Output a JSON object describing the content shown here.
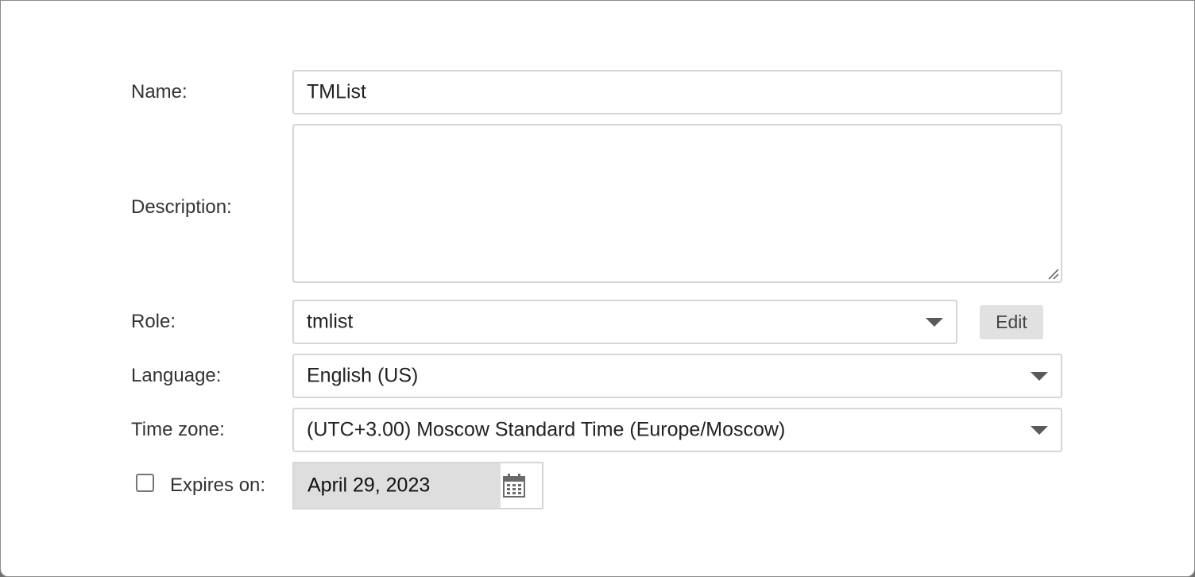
{
  "form": {
    "name": {
      "label": "Name:",
      "value": "TMList"
    },
    "description": {
      "label": "Description:",
      "value": ""
    },
    "role": {
      "label": "Role:",
      "value": "tmlist",
      "edit_label": "Edit"
    },
    "language": {
      "label": "Language:",
      "value": "English (US)"
    },
    "timezone": {
      "label": "Time zone:",
      "value": "(UTC+3.00) Moscow Standard Time (Europe/Moscow)"
    },
    "expires": {
      "label": "Expires on:",
      "checked": false,
      "date": "April 29, 2023"
    }
  },
  "icons": {
    "dropdown": "chevron-down-icon",
    "calendar": "calendar-icon",
    "resize": "resize-grip-icon"
  },
  "colors": {
    "field_border": "#d6d6d6",
    "button_bg": "#e1e1e1",
    "date_bg": "#dedede",
    "label_text": "#333333"
  }
}
